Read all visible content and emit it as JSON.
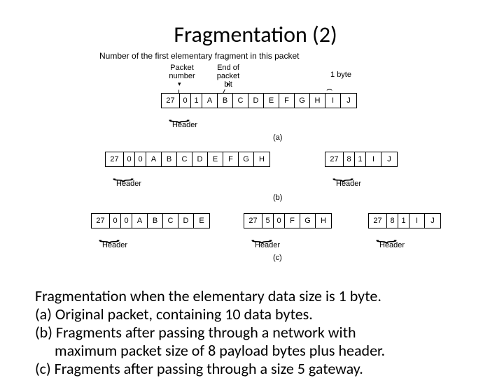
{
  "title": "Fragmentation (2)",
  "caption": "Number of the first elementary fragment in this packet",
  "annotations": {
    "packet_number": "Packet\nnumber",
    "end_of_packet": "End of\npacket bit",
    "one_byte": "1 byte",
    "header": "Header"
  },
  "packets": {
    "a": {
      "cells": [
        "27",
        "0",
        "1",
        "A",
        "B",
        "C",
        "D",
        "E",
        "F",
        "G",
        "H",
        "I",
        "J"
      ],
      "label": "(a)"
    },
    "b": {
      "p1": [
        "27",
        "0",
        "0",
        "A",
        "B",
        "C",
        "D",
        "E",
        "F",
        "G",
        "H"
      ],
      "p2": [
        "27",
        "8",
        "1",
        "I",
        "J"
      ],
      "label": "(b)"
    },
    "c": {
      "p1": [
        "27",
        "0",
        "0",
        "A",
        "B",
        "C",
        "D",
        "E"
      ],
      "p2": [
        "27",
        "5",
        "0",
        "F",
        "G",
        "H"
      ],
      "p3": [
        "27",
        "8",
        "1",
        "I",
        "J"
      ],
      "label": "(c)"
    }
  },
  "explanation": {
    "intro": "Fragmentation when the elementary data size is 1 byte.",
    "a": "(a) Original packet, containing 10 data bytes.",
    "b": "(b) Fragments after passing through a network with",
    "b2": "maximum packet size of 8 payload bytes plus header.",
    "c": "(c) Fragments after passing through a size 5 gateway."
  }
}
